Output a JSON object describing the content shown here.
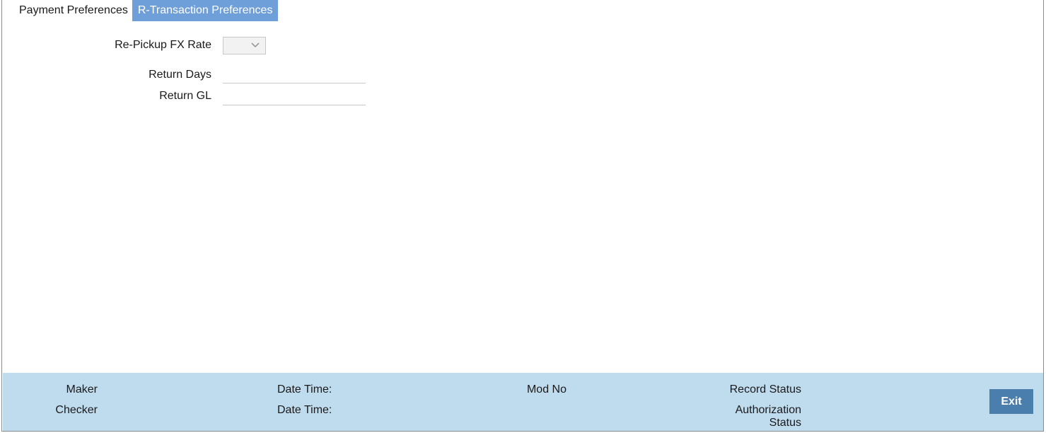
{
  "tabs": [
    {
      "label": "Payment Preferences",
      "active": false
    },
    {
      "label": "R-Transaction Preferences",
      "active": true
    }
  ],
  "form": {
    "repickup_fx_rate": {
      "label": "Re-Pickup FX Rate",
      "value": ""
    },
    "return_days": {
      "label": "Return Days",
      "value": ""
    },
    "return_gl": {
      "label": "Return GL",
      "value": ""
    }
  },
  "footer": {
    "maker_label": "Maker",
    "checker_label": "Checker",
    "date_time_label_1": "Date Time:",
    "date_time_label_2": "Date Time:",
    "mod_no_label": "Mod No",
    "record_status_label": "Record Status",
    "authorization_status_label_line1": "Authorization",
    "authorization_status_label_line2": "Status",
    "exit_label": "Exit"
  },
  "colors": {
    "active_tab": "#6f9fd8",
    "footer_bg": "#bfdbee",
    "exit_button": "#4a7fad"
  },
  "icons": {
    "select_chevron": "chevron-down-icon"
  }
}
